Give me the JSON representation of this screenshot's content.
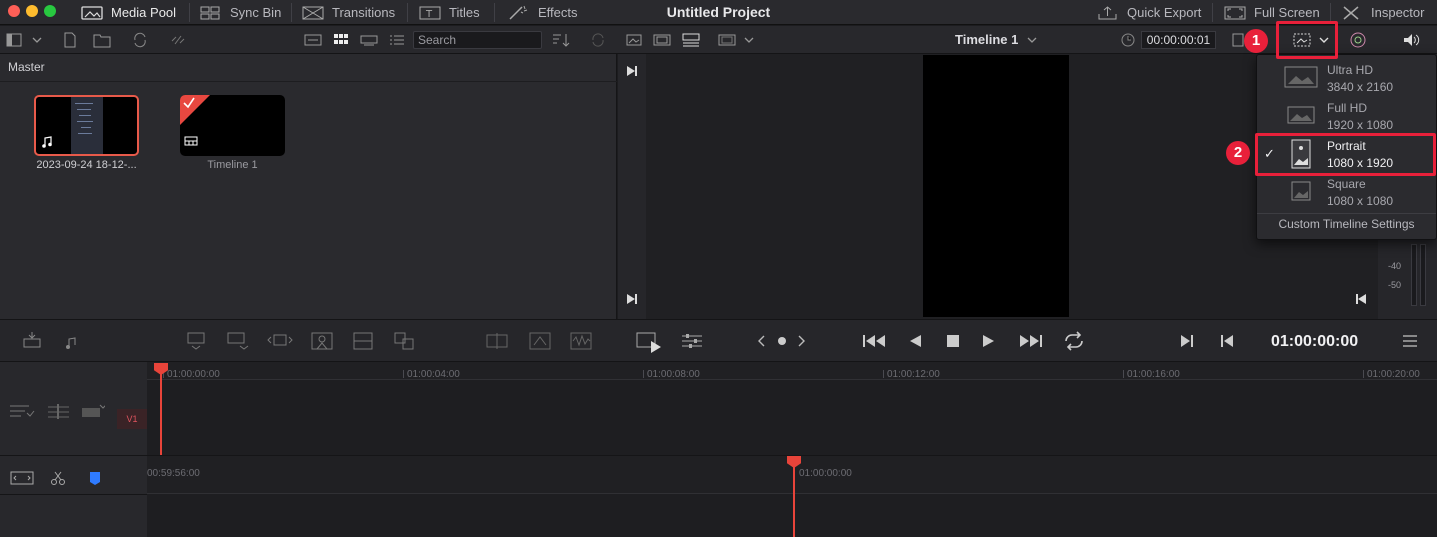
{
  "window": {
    "project_title": "Untitled Project"
  },
  "nav": {
    "left": [
      {
        "label": "Media Pool",
        "icon": "media-pool-icon",
        "active": true
      },
      {
        "label": "Sync Bin",
        "icon": "sync-bin-icon"
      },
      {
        "label": "Transitions",
        "icon": "transitions-icon"
      },
      {
        "label": "Titles",
        "icon": "titles-icon"
      },
      {
        "label": "Effects",
        "icon": "effects-icon"
      }
    ],
    "right": [
      {
        "label": "Quick Export",
        "icon": "export-icon"
      },
      {
        "label": "Full Screen",
        "icon": "fullscreen-icon"
      },
      {
        "label": "Inspector",
        "icon": "inspector-icon"
      }
    ]
  },
  "toolbar": {
    "search_placeholder": "Search",
    "timeline_name": "Timeline 1",
    "source_timecode": "00:00:00:01"
  },
  "media_pool": {
    "bin_name": "Master",
    "clips": [
      {
        "label": "2023-09-24 18-12-...",
        "type": "audio-video"
      },
      {
        "label": "Timeline 1",
        "type": "timeline"
      }
    ]
  },
  "resolution_menu": {
    "items": [
      {
        "name": "Ultra HD",
        "size": "3840 x 2160",
        "selected": false
      },
      {
        "name": "Full HD",
        "size": "1920 x 1080",
        "selected": false
      },
      {
        "name": "Portrait",
        "size": "1080 x 1920",
        "selected": true
      },
      {
        "name": "Square",
        "size": "1080 x 1080",
        "selected": false
      }
    ],
    "custom_label": "Custom Timeline Settings",
    "checkmark": "✓"
  },
  "annotations": {
    "step1": "1",
    "step2": "2"
  },
  "meters": {
    "labels": [
      "-40",
      "-50"
    ]
  },
  "transport": {
    "timecode": "01:00:00:00"
  },
  "timeline": {
    "track_label": "V1",
    "upper_ruler": [
      "01:00:00:00",
      "01:00:04:00",
      "01:00:08:00",
      "01:00:12:00",
      "01:00:16:00",
      "01:00:20:00"
    ],
    "lower_ruler": [
      "00:59:56:00",
      "01:00:00:00"
    ]
  },
  "colors": {
    "accent_red": "#e8203a",
    "playhead": "#e8443a",
    "clip_border": "#e85a4a"
  }
}
